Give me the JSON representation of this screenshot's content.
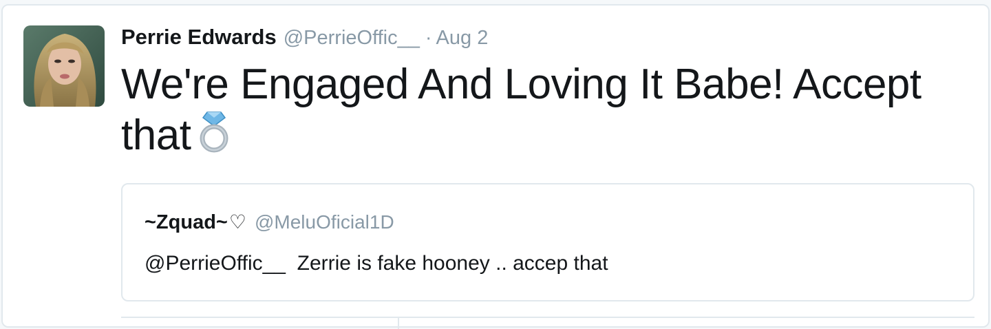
{
  "tweet": {
    "display_name": "Perrie Edwards",
    "handle": "@PerrieOffic__",
    "separator": "·",
    "timestamp": "Aug 2",
    "text": "We're Engaged And Loving It Babe! Accept that",
    "emoji_icon": "ring-icon",
    "avatar_icon": "profile-photo"
  },
  "quoted_tweet": {
    "display_name": "~Zquad~",
    "heart": "♡",
    "handle": "@MeluOficial1D",
    "text": "@PerrieOffic__  Zerrie is fake hooney .. accep that"
  },
  "colors": {
    "text_primary": "#14171a",
    "text_secondary": "#8899a6",
    "border": "#e1e8ed",
    "background": "#ffffff",
    "ring_diamond": "#6fb7e6",
    "ring_band": "#a9b4bd"
  }
}
